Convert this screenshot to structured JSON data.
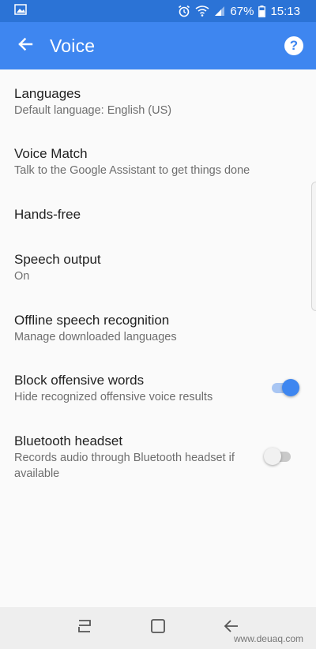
{
  "status_bar": {
    "battery": "67%",
    "time": "15:13",
    "icons": [
      "image-icon",
      "alarm-icon",
      "wifi-icon",
      "signal-icon",
      "battery-icon"
    ]
  },
  "app_bar": {
    "title": "Voice",
    "back_icon": "arrow-left-icon",
    "help_label": "?"
  },
  "settings": [
    {
      "title": "Languages",
      "subtitle": "Default language: English (US)"
    },
    {
      "title": "Voice Match",
      "subtitle": "Talk to the Google Assistant to get things done"
    },
    {
      "title": "Hands-free",
      "subtitle": ""
    },
    {
      "title": "Speech output",
      "subtitle": "On"
    },
    {
      "title": "Offline speech recognition",
      "subtitle": "Manage downloaded languages"
    },
    {
      "title": "Block offensive words",
      "subtitle": "Hide recognized offensive voice results",
      "toggle": "on"
    },
    {
      "title": "Bluetooth headset",
      "subtitle": "Records audio through Bluetooth headset if available",
      "toggle": "off"
    }
  ],
  "nav_bar": {
    "icons": [
      "recent-apps-icon",
      "home-icon",
      "back-icon"
    ]
  },
  "watermark": "www.deuaq.com",
  "colors": {
    "app_bar": "#3e86f0",
    "status_bar": "#2b73d6",
    "toggle_on": "#3e86f0"
  }
}
